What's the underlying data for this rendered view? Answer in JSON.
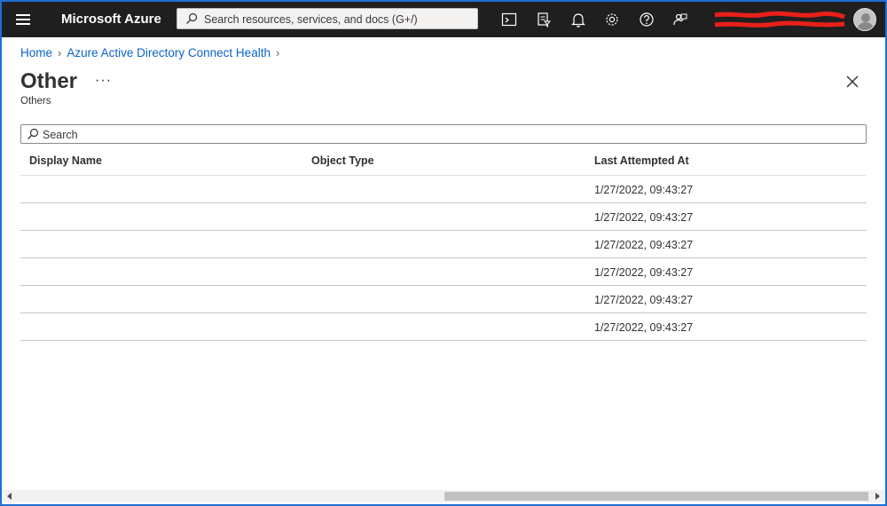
{
  "topbar": {
    "brand": "Microsoft Azure",
    "search_placeholder": "Search resources, services, and docs (G+/)",
    "icons": [
      "cloud-shell-icon",
      "directory-filter-icon",
      "notifications-icon",
      "settings-icon",
      "help-icon",
      "feedback-icon"
    ]
  },
  "breadcrumb": {
    "items": [
      "Home",
      "Azure Active Directory Connect Health"
    ]
  },
  "page": {
    "title": "Other",
    "more": "···",
    "subtitle": "Others"
  },
  "filter": {
    "placeholder": "Search"
  },
  "table": {
    "columns": [
      "Display Name",
      "Object Type",
      "Last Attempted At"
    ],
    "rows": [
      {
        "display_name": "",
        "object_type": "",
        "last_attempted": "1/27/2022, 09:43:27"
      },
      {
        "display_name": "",
        "object_type": "",
        "last_attempted": "1/27/2022, 09:43:27"
      },
      {
        "display_name": "",
        "object_type": "",
        "last_attempted": "1/27/2022, 09:43:27"
      },
      {
        "display_name": "",
        "object_type": "",
        "last_attempted": "1/27/2022, 09:43:27"
      },
      {
        "display_name": "",
        "object_type": "",
        "last_attempted": "1/27/2022, 09:43:27"
      },
      {
        "display_name": "",
        "object_type": "",
        "last_attempted": "1/27/2022, 09:43:27"
      }
    ]
  },
  "colors": {
    "topbar": "#1f1f1f",
    "link": "#0a63c8",
    "redaction": "#e8201a"
  }
}
